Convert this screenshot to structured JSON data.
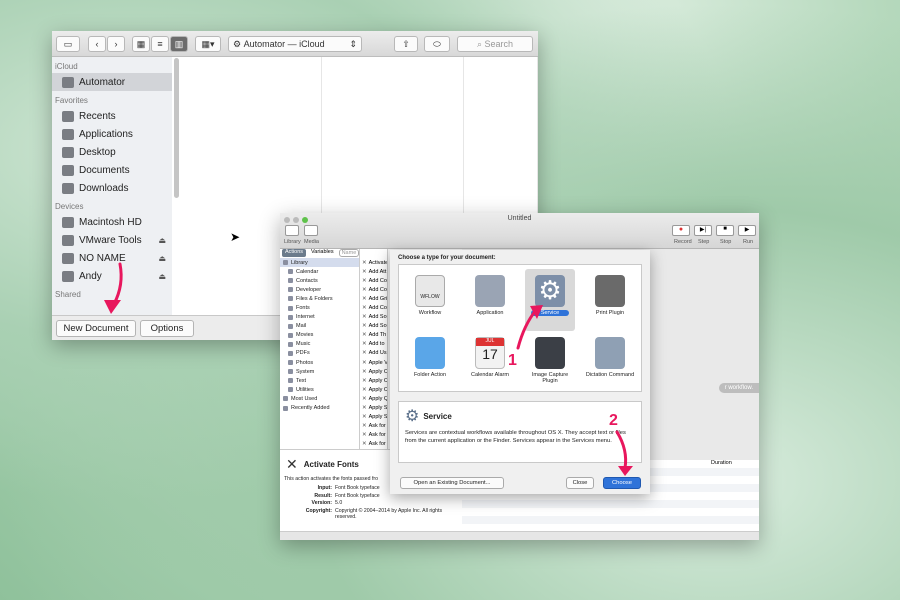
{
  "finder": {
    "path_label": "Automator — iCloud",
    "search_placeholder": "Search",
    "sections": [
      {
        "header": "iCloud",
        "items": [
          {
            "label": "Automator",
            "icon": "automator-icon",
            "selected": true
          }
        ]
      },
      {
        "header": "Favorites",
        "items": [
          {
            "label": "Recents",
            "icon": "recents-icon"
          },
          {
            "label": "Applications",
            "icon": "applications-icon"
          },
          {
            "label": "Desktop",
            "icon": "desktop-icon"
          },
          {
            "label": "Documents",
            "icon": "documents-icon"
          },
          {
            "label": "Downloads",
            "icon": "downloads-icon"
          }
        ]
      },
      {
        "header": "Devices",
        "items": [
          {
            "label": "Macintosh HD",
            "icon": "disk-icon"
          },
          {
            "label": "VMware Tools",
            "icon": "cd-icon",
            "eject": true
          },
          {
            "label": "NO NAME",
            "icon": "drive-icon",
            "eject": true
          },
          {
            "label": "Andy",
            "icon": "drive-icon",
            "eject": true
          }
        ]
      },
      {
        "header": "Shared",
        "items": []
      }
    ],
    "new_document": "New Document",
    "options": "Options"
  },
  "automator": {
    "title": "Untitled",
    "toolbar_left": [
      "Library",
      "Media"
    ],
    "toolbar_right": [
      "Record",
      "Step",
      "Stop",
      "Run"
    ],
    "tabs": [
      "Actions",
      "Variables"
    ],
    "search_placeholder": "Name",
    "library": [
      "Library",
      "Calendar",
      "Contacts",
      "Developer",
      "Files & Folders",
      "Fonts",
      "Internet",
      "Mail",
      "Movies",
      "Music",
      "PDFs",
      "Photos",
      "System",
      "Text",
      "Utilities",
      "Most Used",
      "Recently Added"
    ],
    "actions": [
      "Activate",
      "Add Att",
      "Add Co",
      "Add Co",
      "Add Gri",
      "Add Co",
      "Add So",
      "Add So",
      "Add Th",
      "Add to",
      "Add Us",
      "Apple V",
      "Apply C",
      "Apply C",
      "Apply C",
      "Apply Q",
      "Apply S",
      "Apply S",
      "Ask for",
      "Ask for",
      "Ask for",
      "Ask for"
    ],
    "desc_title": "Activate Fonts",
    "desc_text": "This action activates the fonts passed fro",
    "desc_rows": [
      {
        "k": "Input:",
        "v": "Font Book typeface"
      },
      {
        "k": "Result:",
        "v": "Font Book typeface"
      },
      {
        "k": "Version:",
        "v": "5.0"
      },
      {
        "k": "Copyright:",
        "v": "Copyright © 2004–2014 by Apple Inc. All rights reserved."
      }
    ],
    "workflow_hint": "r workflow.",
    "duration_header": "Duration"
  },
  "sheet": {
    "prompt": "Choose a type for your document:",
    "types": [
      {
        "label": "Workflow",
        "color": "#e8e8e8"
      },
      {
        "label": "Application",
        "color": "#9aa4b4"
      },
      {
        "label": "Service",
        "color": "#7d8fa8",
        "selected": true
      },
      {
        "label": "Print Plugin",
        "color": "#6a6a6a"
      },
      {
        "label": "Folder Action",
        "color": "#5aa6e8"
      },
      {
        "label": "Calendar Alarm",
        "color": "#f2f2f2"
      },
      {
        "label": "Image Capture Plugin",
        "color": "#3b3f46"
      },
      {
        "label": "Dictation Command",
        "color": "#8fa0b4"
      }
    ],
    "info_title": "Service",
    "info_text": "Services are contextual workflows available throughout OS X. They accept text or files from the current application or the Finder. Services appear in the Services menu.",
    "open_existing": "Open an Existing Document...",
    "close": "Close",
    "choose": "Choose",
    "calendar_day": "17",
    "calendar_month": "JUL",
    "workflow_tag": "WFLOW"
  },
  "annotations": [
    "1",
    "2"
  ],
  "colors": {
    "accent": "#e8175d",
    "select_blue": "#2f73d9"
  }
}
